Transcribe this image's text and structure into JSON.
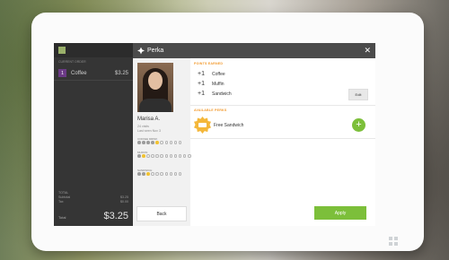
{
  "pos": {
    "section_label": "CURRENT ORDER",
    "items": [
      {
        "qty": "1",
        "name": "Coffee",
        "price": "$3.25"
      }
    ],
    "subtotal_label": "Subtotal",
    "subtotal_value": "$3.25",
    "tax_label": "Tax",
    "tax_value": "$0.00",
    "total_label": "Total",
    "total_value": "$3.25",
    "totals_heading": "TOTAL"
  },
  "modal": {
    "brand": "Perka",
    "close_icon": "close-icon",
    "customer": {
      "name": "Marisa A.",
      "visits": "24 visits",
      "last_seen": "Last seen Nov 3",
      "tracks": [
        {
          "label": "COFFEE DRINK",
          "filled": 4,
          "gold": 1,
          "total": 10
        },
        {
          "label": "MUFFIN",
          "filled": 1,
          "gold": 1,
          "total": 12
        },
        {
          "label": "SANDWICH",
          "filled": 2,
          "gold": 1,
          "total": 10
        }
      ]
    },
    "points_title": "POINTS EARNED",
    "points": [
      {
        "plus": "+1",
        "item": "Coffee"
      },
      {
        "plus": "+1",
        "item": "Muffin"
      },
      {
        "plus": "+1",
        "item": "Sandwich"
      }
    ],
    "edit_label": "Edit",
    "perks_title": "AVAILABLE PERKS",
    "perks": [
      {
        "name": "Free Sandwich"
      }
    ],
    "back_label": "Back",
    "apply_label": "Apply",
    "colors": {
      "accent": "#f29a2f",
      "green": "#7cbf3a",
      "gold": "#f1c232",
      "header": "#4b4b4b"
    }
  }
}
